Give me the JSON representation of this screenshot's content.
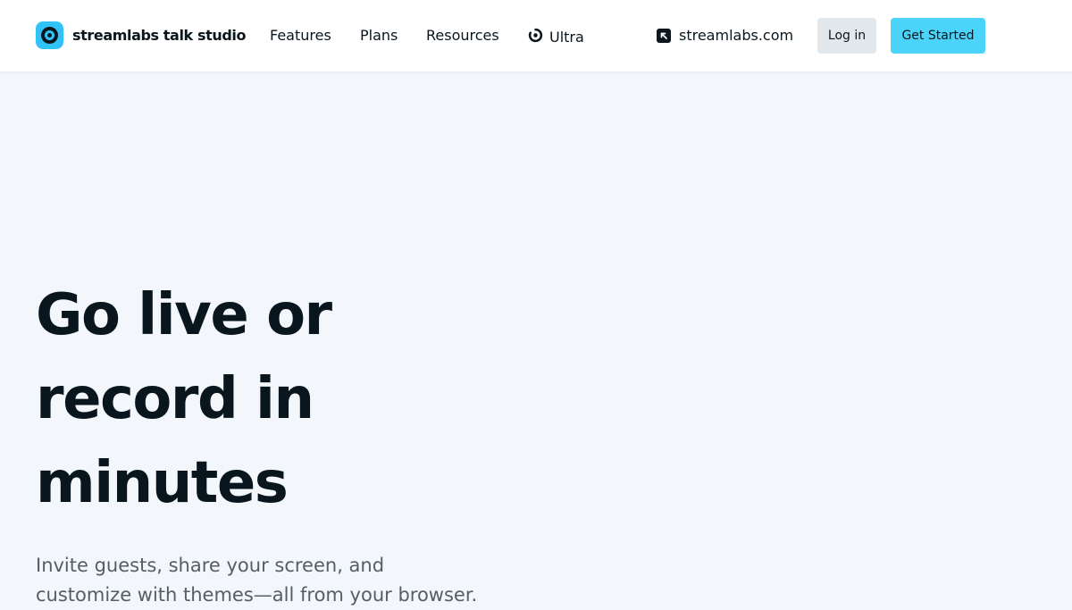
{
  "header": {
    "brand_name": "streamlabs talk studio",
    "nav": {
      "features": "Features",
      "plans": "Plans",
      "resources": "Resources",
      "ultra": "Ultra"
    },
    "site_link": "streamlabs.com",
    "login_label": "Log in",
    "get_started_label": "Get Started",
    "icons": {
      "brand": "streamlabs-logo-icon",
      "ultra": "ultra-icon",
      "external": "external-link-icon"
    }
  },
  "hero": {
    "title_lines": [
      "Go live or",
      "record in",
      "minutes"
    ],
    "subtitle_lines": [
      "Invite guests, share your screen, and",
      "customize with themes—all from your browser."
    ]
  },
  "colors": {
    "page_bg": "#f3f6fb",
    "header_bg": "#ffffff",
    "accent": "#4cd3f9",
    "login_bg": "#e3e8ec",
    "text_dark": "#09161d",
    "text_muted": "#545e66"
  }
}
